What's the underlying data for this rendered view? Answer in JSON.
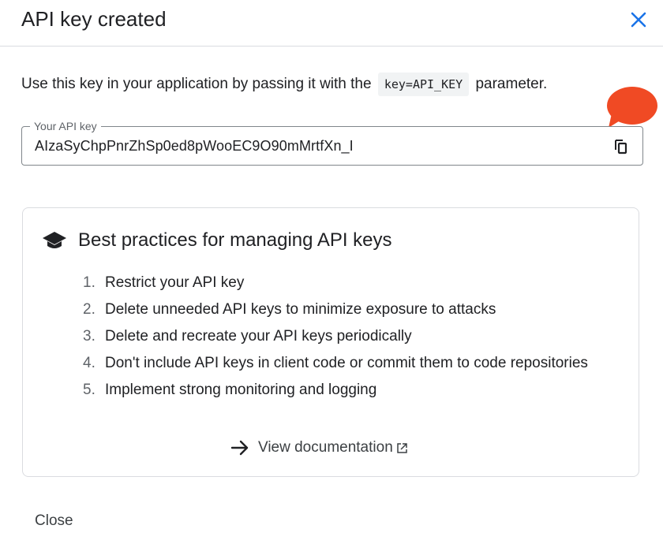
{
  "dialog": {
    "title": "API key created",
    "intro_before": "Use this key in your application by passing it with the ",
    "intro_code": "key=API_KEY",
    "intro_after": " parameter."
  },
  "api_key_field": {
    "label": "Your API key",
    "value": "AIzaSyChpPnrZhSp0ed8pWooEC9O90mMrtfXn_I"
  },
  "best_practices": {
    "title": "Best practices for managing API keys",
    "items": [
      {
        "num": "1.",
        "text": "Restrict your API key"
      },
      {
        "num": "2.",
        "text": "Delete unneeded API keys to minimize exposure to attacks"
      },
      {
        "num": "3.",
        "text": "Delete and recreate your API keys periodically"
      },
      {
        "num": "4.",
        "text": "Don't include API keys in client code or commit them to code repositories"
      },
      {
        "num": "5.",
        "text": "Implement strong monitoring and logging"
      }
    ],
    "doc_link_label": "View documentation"
  },
  "footer": {
    "close_label": "Close"
  },
  "icons": {
    "close": "close-icon",
    "copy": "copy-icon",
    "school": "school-icon",
    "arrow": "arrow-forward-icon",
    "external": "open-in-new-icon"
  },
  "colors": {
    "accent": "#1a73e8",
    "marker": "#f04a24",
    "border": "#dadce0",
    "text": "#202124"
  }
}
